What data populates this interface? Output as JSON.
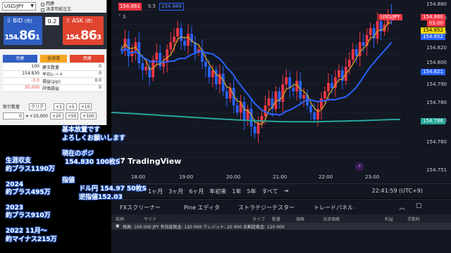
{
  "order": {
    "pair": "USD/JPY",
    "checkboxes": [
      "両建",
      "決済可能注文"
    ],
    "bid_label": "BID",
    "bid_sub": "(売)",
    "bid_main": "154.",
    "bid_big": "86",
    "bid_small": "1",
    "ask_label": "ASK",
    "ask_sub": "(買)",
    "ask_main": "154.",
    "ask_big": "86",
    "ask_small": "3",
    "spread": "0.2",
    "spread_sub": "",
    "buttons": [
      "売建",
      "全決済",
      "買建"
    ],
    "position_rows": [
      {
        "value": "100",
        "label": "建玉数量",
        "right": "0"
      },
      {
        "value": "154.830",
        "label": "平均レート",
        "right": "0"
      },
      {
        "value": "-3.3",
        "label": "損益(pip)",
        "right": "0.0"
      },
      {
        "value": "35,000",
        "label": "評価損益",
        "right": "0"
      }
    ],
    "qty_label": "取引数量",
    "qty_value": "0",
    "clear_label": "クリア",
    "qty_buttons": [
      "+1",
      "+5",
      "+10",
      "+20",
      "+50",
      "+100"
    ],
    "qty_option": "+10,000"
  },
  "chart": {
    "symbol_tag": "USD/JPY",
    "quote_bid": "154.861",
    "quote_spread": "0.5",
    "quote_ask": "154.866",
    "collapse": "3",
    "watermark": "TradingView",
    "price_axis": [
      "154.880",
      "154.860",
      "154.840",
      "154.820",
      "154.800",
      "154.790",
      "154.780",
      "154.770",
      "154.760",
      "154.751"
    ],
    "price_tags": [
      {
        "text": "154.860",
        "bg": "#f23645"
      },
      {
        "text": "03:00",
        "bg": "#f23645"
      },
      {
        "text": "154.852",
        "bg": "#f5d700"
      },
      {
        "text": "154.852",
        "bg": "#2962ff"
      },
      {
        "text": "154.821",
        "bg": "#2962ff"
      },
      {
        "text": "154.786",
        "bg": "#26a69a"
      }
    ],
    "time_axis": [
      "18:00",
      "19:00",
      "20:00",
      "21:00",
      "22:00",
      "23:00"
    ],
    "ranges": [
      "1ヶ月",
      "3ヶ月",
      "6ヶ月",
      "年初来",
      "1年",
      "5年",
      "すべて"
    ],
    "clock": "22:41:59 (UTC+9)"
  },
  "panel": {
    "tabs": [
      "FXスクリーナー",
      "Pine エディタ",
      "ストラテジーテスター",
      "トレードパネル"
    ],
    "headers": [
      "銘柄",
      "サイド",
      "タイプ",
      "数量",
      "価格",
      "決済価格",
      "利益",
      "手数料"
    ],
    "account": "残高: 100 000 JPY  有効証拠金: 120 000  クレジット: 20 000  余剰証拠金: 120 000"
  },
  "overlay": {
    "lines": [
      "基本放置です",
      "よろしくお願いします",
      "現在のポジ",
      "154.830 100枚S",
      "生涯収支",
      "約プラス1190万",
      "指値",
      "ドル円 154.97 50枚S",
      "逆指値152.03",
      "2024",
      "約プラス495万",
      "2023",
      "約プラス910万",
      "2022 11月〜",
      "約マイナス215万"
    ]
  },
  "colors": {
    "up": "#f23645",
    "down": "#2962ff",
    "ma_fast": "#c9a227",
    "ma_slow": "#2962ff",
    "ma_long": "#26a69a"
  }
}
